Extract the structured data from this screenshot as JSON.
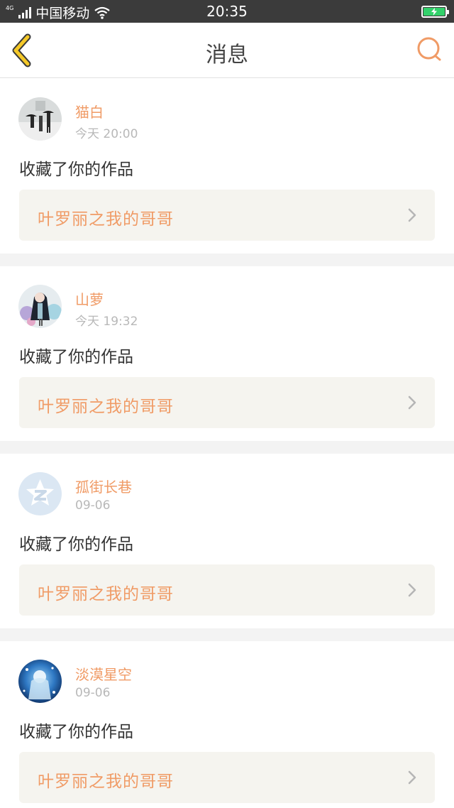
{
  "status_bar": {
    "network_type": "4G",
    "carrier": "中国移动",
    "time": "20:35"
  },
  "nav": {
    "title": "消息",
    "back_icon": "chevron-left-icon",
    "search_icon": "search-icon"
  },
  "colors": {
    "accent": "#f09b66",
    "back_icon": "#f5c928",
    "card_link_bg": "#f5f4ef",
    "separator": "#f3f3f3"
  },
  "messages": [
    {
      "user": "猫白",
      "time": "今天 20:00",
      "action": "收藏了你的作品",
      "work_title": "叶罗丽之我的哥哥"
    },
    {
      "user": "山萝",
      "time": "今天 19:32",
      "action": "收藏了你的作品",
      "work_title": "叶罗丽之我的哥哥"
    },
    {
      "user": "孤街长巷",
      "time": "09-06",
      "action": "收藏了你的作品",
      "work_title": "叶罗丽之我的哥哥"
    },
    {
      "user": "淡漠星空",
      "time": "09-06",
      "action": "收藏了你的作品",
      "work_title": "叶罗丽之我的哥哥"
    }
  ]
}
